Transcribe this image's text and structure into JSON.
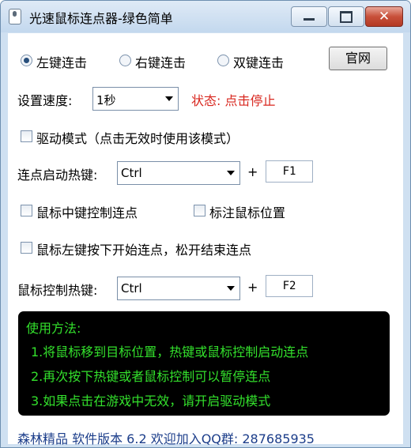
{
  "window": {
    "title": "光速鼠标连点器-绿色简单",
    "controls": {
      "minimize_icon": "minimize-icon",
      "maximize_icon": "maximize-icon",
      "close_icon": "close-icon",
      "close_glyph": "✕"
    }
  },
  "click_mode": {
    "options": [
      {
        "label": "左键连击",
        "selected": true
      },
      {
        "label": "右键连击",
        "selected": false
      },
      {
        "label": "双键连击",
        "selected": false
      }
    ]
  },
  "website_button": {
    "label": "官网"
  },
  "speed": {
    "label": "设置速度:",
    "value": "1秒"
  },
  "status": {
    "text": "状态: 点击停止",
    "color": "#d8261e"
  },
  "driver_mode": {
    "label": "驱动模式（点击无效时使用该模式）",
    "checked": false
  },
  "start_hotkey": {
    "label": "连点启动热键:",
    "modifier": "Ctrl",
    "plus": "+",
    "key": "F1"
  },
  "middle_button_control": {
    "label": "鼠标中键控制连点",
    "checked": false
  },
  "mark_position": {
    "label": "标注鼠标位置",
    "checked": false
  },
  "left_hold_mode": {
    "label": "鼠标左键按下开始连点，松开结束连点",
    "checked": false
  },
  "mouse_control_hotkey": {
    "label": "鼠标控制热键:",
    "modifier": "Ctrl",
    "plus": "+",
    "key": "F2"
  },
  "usage": {
    "title": "使用方法:",
    "lines": [
      "1.将鼠标移到目标位置，热键或鼠标控制启动连点",
      "2.再次按下热键或者鼠标控制可以暂停连点",
      "3.如果点击在游戏中无效，请开启驱动模式"
    ],
    "text_color": "#33e02c"
  },
  "footer": {
    "text": "森林精品 软件版本 6.2 欢迎加入QQ群: 287685935"
  }
}
